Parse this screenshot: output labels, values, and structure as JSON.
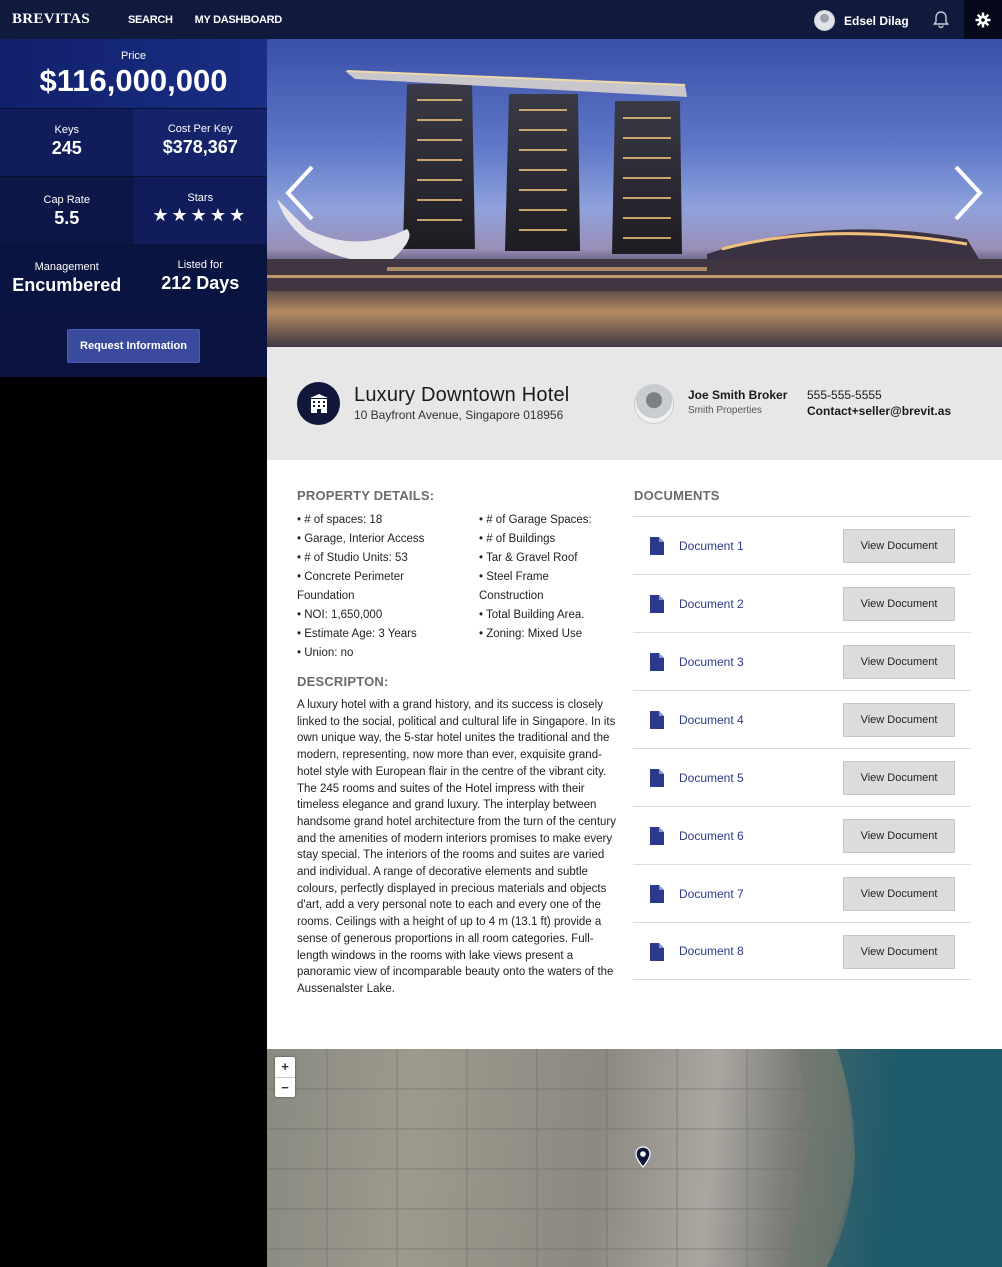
{
  "app": {
    "logo": "BREVITAS",
    "nav": [
      "SEARCH",
      "MY DASHBOARD"
    ],
    "user_name": "Edsel Dilag"
  },
  "stats": {
    "price_label": "Price",
    "price": "$116,000,000",
    "keys_label": "Keys",
    "keys": "245",
    "cpk_label": "Cost Per Key",
    "cpk": "$378,367",
    "cap_label": "Cap Rate",
    "cap": "5.5",
    "stars_label": "Stars",
    "stars": "★★★★★",
    "star_count": 5,
    "mgmt_label": "Management",
    "mgmt": "Encumbered",
    "listed_label": "Listed for",
    "listed": "212 Days",
    "request_button": "Request Information"
  },
  "property": {
    "title": "Luxury Downtown Hotel",
    "address": "10 Bayfront Avenue, Singapore 018956"
  },
  "broker": {
    "name": "Joe Smith Broker",
    "company": "Smith Properties",
    "phone": "555-555-5555",
    "email": "Contact+seller@brevit.as"
  },
  "details": {
    "heading": "PROPERTY DETAILS:",
    "left": [
      "• # of spaces: 18",
      "• Garage, Interior Access",
      "• # of Studio Units: 53",
      "• Concrete Perimeter",
      "Foundation",
      "• NOI: 1,650,000",
      "• Estimate Age: 3 Years",
      "• Union: no"
    ],
    "right": [
      "• # of Garage Spaces:",
      "• # of Buildings",
      "• Tar & Gravel Roof",
      "• Steel Frame",
      "Construction",
      "• Total Building Area.",
      "• Zoning: Mixed Use"
    ]
  },
  "description": {
    "heading": "DESCRIPTON:",
    "text": "A luxury hotel with a grand history, and its success is closely linked to the social, political and cultural life in Singapore. In its own unique way, the 5-star hotel unites the traditional and the modern, representing, now more than ever, exquisite grand-hotel style with European flair in the centre of the vibrant city. The 245 rooms and suites of the Hotel impress with their timeless elegance and grand luxury. The interplay between handsome grand hotel architecture from the turn of the century and the amenities of modern interiors promises to make every stay special. The interiors of the rooms and suites are varied and individual. A range of decorative elements and subtle colours, perfectly displayed in precious materials and objects d'art, add a very personal note to each and every one of the rooms. Ceilings with a height of up to 4 m (13.1 ft) provide a sense of generous proportions in all room categories. Full-length windows in the rooms with lake views present a panoramic view of incomparable beauty onto the waters of the Aussenalster Lake."
  },
  "documents": {
    "heading": "DOCUMENTS",
    "button": "View Document",
    "items": [
      "Document 1",
      "Document 2",
      "Document 3",
      "Document 4",
      "Document 5",
      "Document 6",
      "Document 7",
      "Document 8"
    ]
  },
  "map": {
    "zoom_in": "+",
    "zoom_out": "−"
  }
}
